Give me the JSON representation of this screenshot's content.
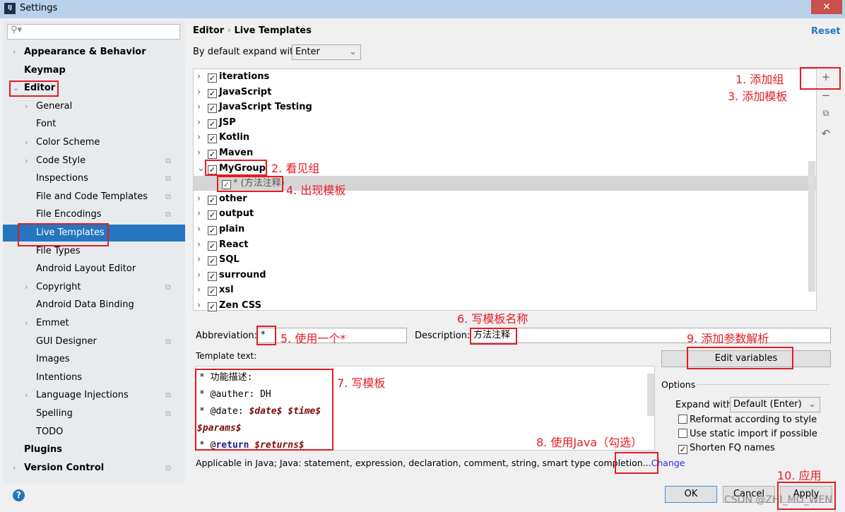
{
  "window": {
    "title": "Settings",
    "logo": "IJ",
    "close": "✕"
  },
  "sidebar": {
    "search_placeholder": "",
    "items": [
      {
        "label": "Appearance & Behavior"
      },
      {
        "label": "Keymap"
      },
      {
        "label": "Editor"
      },
      {
        "label": "General"
      },
      {
        "label": "Font"
      },
      {
        "label": "Color Scheme"
      },
      {
        "label": "Code Style"
      },
      {
        "label": "Inspections"
      },
      {
        "label": "File and Code Templates"
      },
      {
        "label": "File Encodings"
      },
      {
        "label": "Live Templates"
      },
      {
        "label": "File Types"
      },
      {
        "label": "Android Layout Editor"
      },
      {
        "label": "Copyright"
      },
      {
        "label": "Android Data Binding"
      },
      {
        "label": "Emmet"
      },
      {
        "label": "GUI Designer"
      },
      {
        "label": "Images"
      },
      {
        "label": "Intentions"
      },
      {
        "label": "Language Injections"
      },
      {
        "label": "Spelling"
      },
      {
        "label": "TODO"
      },
      {
        "label": "Plugins"
      },
      {
        "label": "Version Control"
      }
    ]
  },
  "header": {
    "crumb1": "Editor",
    "sep": "›",
    "crumb2": "Live Templates",
    "reset": "Reset"
  },
  "expand_default": {
    "label": "By default expand with",
    "value": "Enter"
  },
  "groups": [
    {
      "name": "iterations"
    },
    {
      "name": "JavaScript"
    },
    {
      "name": "JavaScript Testing"
    },
    {
      "name": "JSP"
    },
    {
      "name": "Kotlin"
    },
    {
      "name": "Maven"
    },
    {
      "name": "MyGroup"
    },
    {
      "name": "* (方法注释)"
    },
    {
      "name": "other"
    },
    {
      "name": "output"
    },
    {
      "name": "plain"
    },
    {
      "name": "React"
    },
    {
      "name": "SQL"
    },
    {
      "name": "surround"
    },
    {
      "name": "xsl"
    },
    {
      "name": "Zen CSS"
    }
  ],
  "form": {
    "abbr_label": "Abbreviation:",
    "abbr_value": "*",
    "desc_label": "Description:",
    "desc_value": "方法注释",
    "template_label": "Template text:",
    "edit_vars": "Edit variables",
    "template_lines": {
      "l1": "* 功能描述:",
      "l2": "* @auther: DH",
      "l3a": "* @date: ",
      "l3b": "$date$",
      "l3c": " $time$",
      "l4": "$params$",
      "l5a": "* @",
      "l5b": "return",
      "l5c": " $returns$"
    },
    "applicable": "Applicable in Java; Java: statement, expression, declaration, comment, string, smart type completion...",
    "change": "Change"
  },
  "options": {
    "title": "Options",
    "expand_label": "Expand with",
    "expand_value": "Default (Enter)",
    "reformat": "Reformat according to style",
    "static_import": "Use static import if possible",
    "shorten": "Shorten FQ names",
    "reformat_checked": false,
    "static_checked": false,
    "shorten_checked": true
  },
  "footer": {
    "ok": "OK",
    "cancel": "Cancel",
    "apply": "Apply",
    "help": "?",
    "watermark": "CSDN @ZHI_MO_WEN"
  },
  "annotations": {
    "a1": "1. 添加组",
    "a3": "3. 添加模板",
    "a2": "2. 看见组",
    "a4": "4. 出现模板",
    "a5": "5. 使用一个*",
    "a6": "6. 写模板名称",
    "a7": "7. 写模板",
    "a8": "8. 使用Java（勾选）",
    "a9": "9. 添加参数解析",
    "a10": "10. 应用"
  },
  "colors": {
    "selection": "#2675bf",
    "annotation": "#e51c23",
    "link": "#2b2bf0"
  }
}
